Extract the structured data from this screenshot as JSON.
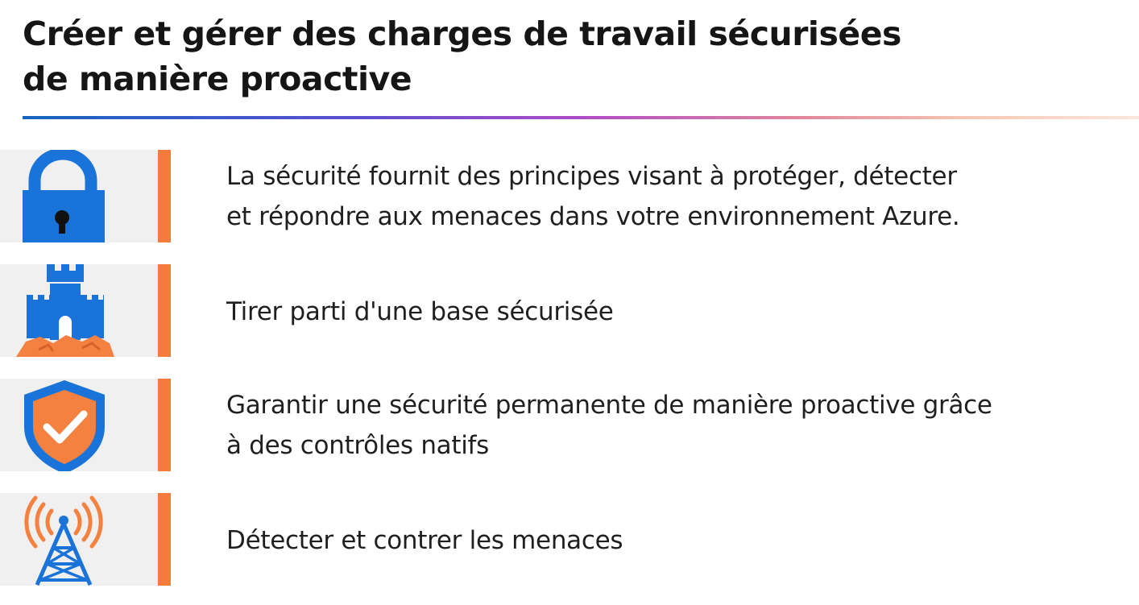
{
  "slide": {
    "title_lines": [
      "Créer et gérer des charges de travail sécurisées",
      "de manière proactive"
    ]
  },
  "rows": [
    {
      "icon": "padlock-icon",
      "lines": [
        "La sécurité fournit des principes visant à protéger, détecter",
        "et répondre aux menaces dans votre environnement Azure."
      ]
    },
    {
      "icon": "castle-icon",
      "lines": [
        "Tirer parti d'une base sécurisée"
      ]
    },
    {
      "icon": "shield-check-icon",
      "lines": [
        "Garantir une sécurité permanente de manière proactive grâce",
        "à des contrôles natifs"
      ]
    },
    {
      "icon": "antenna-tower-icon",
      "lines": [
        "Détecter et contrer les menaces"
      ]
    }
  ],
  "colors": {
    "accent_orange": "#f47b3b",
    "icon_blue": "#1a73d9",
    "icon_panel": "#f0f0f0"
  }
}
